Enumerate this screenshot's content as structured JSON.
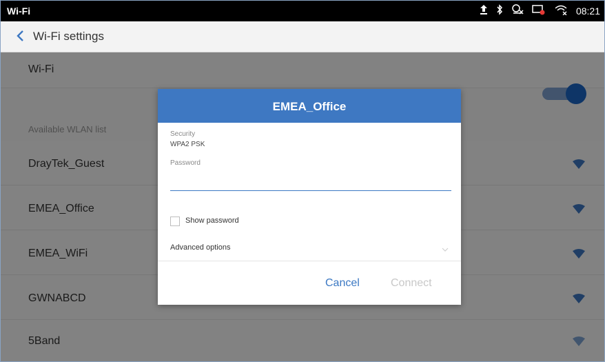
{
  "status_bar": {
    "title": "Wi-Fi",
    "time": "08:21",
    "icons": [
      "upload-icon",
      "bluetooth-icon",
      "no-location-icon",
      "camera-off-icon",
      "wifi-off-icon"
    ]
  },
  "app_bar": {
    "back_icon": "chevron-left-icon",
    "title": "Wi-Fi settings"
  },
  "settings": {
    "wifi_label": "Wi-Fi",
    "wifi_enabled": true,
    "section_header": "Available WLAN list",
    "networks": [
      {
        "name": "DrayTek_Guest",
        "icon": "wifi-lock-icon"
      },
      {
        "name": "EMEA_Office",
        "icon": "wifi-lock-icon"
      },
      {
        "name": "EMEA_WiFi",
        "icon": "wifi-lock-icon"
      },
      {
        "name": "GWNABCD",
        "icon": "wifi-lock-icon"
      },
      {
        "name": "5Band",
        "icon": "wifi-lock-icon"
      }
    ]
  },
  "dialog": {
    "title": "EMEA_Office",
    "security_label": "Security",
    "security_value": "WPA2 PSK",
    "password_label": "Password",
    "password_value": "",
    "show_password_label": "Show password",
    "show_password_checked": false,
    "advanced_label": "Advanced options",
    "cancel_label": "Cancel",
    "connect_label": "Connect"
  },
  "colors": {
    "accent": "#3e78c2",
    "toggle_on": "#1b67c6",
    "status_bar": "#000000",
    "disabled_text": "#c8c8c8"
  }
}
